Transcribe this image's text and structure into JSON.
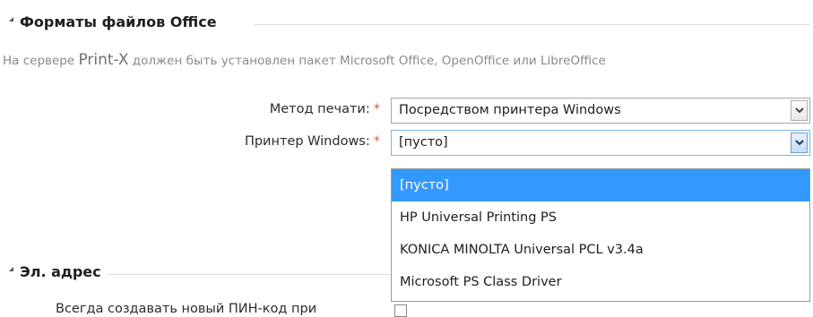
{
  "section_office": {
    "title": "Форматы файлов Office"
  },
  "note": {
    "prefix": "На сервере ",
    "product": "Print-X",
    "suffix": " должен быть установлен пакет Microsoft Office, OpenOffice или LibreOffice"
  },
  "print_method": {
    "label": "Метод печати:",
    "required_mark": "*",
    "value": "Посредством принтера Windows"
  },
  "windows_printer": {
    "label": "Принтер Windows:",
    "required_mark": "*",
    "value": "[пусто]",
    "options": [
      "[пусто]",
      "HP Universal Printing PS",
      "KONICA MINOLTA Universal PCL v3.4a",
      "Microsoft PS Class Driver"
    ],
    "selected_index": 0
  },
  "section_email": {
    "title": "Эл. адрес"
  },
  "always_new_pin": {
    "label": "Всегда создавать новый ПИН-код при",
    "checked": false
  },
  "colors": {
    "selection": "#3399ff",
    "required": "#e05050"
  }
}
